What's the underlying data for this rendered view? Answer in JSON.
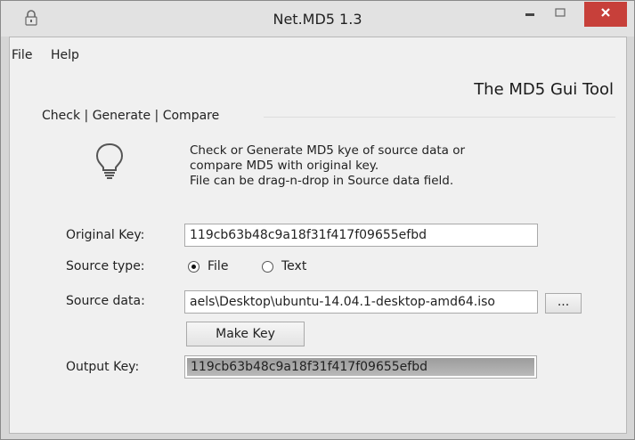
{
  "window": {
    "title": "Net.MD5 1.3",
    "icons": {
      "app": "lock-icon",
      "minimize": "minimize-icon",
      "maximize": "maximize-icon",
      "close": "close-icon"
    }
  },
  "menu": {
    "items": [
      "File",
      "Help"
    ]
  },
  "brand": "The MD5 Gui Tool",
  "nav": {
    "links": [
      "Check",
      "Generate",
      "Compare"
    ],
    "separator": "|"
  },
  "info": {
    "icon": "lightbulb-icon",
    "lines": [
      "Check or Generate MD5 kye of source data or",
      "compare MD5 with original key.",
      "File can be drag-n-drop in Source data field."
    ]
  },
  "form": {
    "original_key_label": "Original Key:",
    "original_key_value": "119cb63b48c9a18f31f417f09655efbd",
    "source_type_label": "Source type:",
    "source_type_options": [
      "File",
      "Text"
    ],
    "source_type_selected": "File",
    "source_data_label": "Source data:",
    "source_data_value": "aels\\Desktop\\ubuntu-14.04.1-desktop-amd64.iso",
    "browse_label": "...",
    "make_key_label": "Make Key",
    "output_key_label": "Output Key:",
    "output_key_value": "119cb63b48c9a18f31f417f09655efbd",
    "output_progress": 1.0
  },
  "colors": {
    "close_button": "#c7403a",
    "output_fill": "#a8a8a8"
  }
}
